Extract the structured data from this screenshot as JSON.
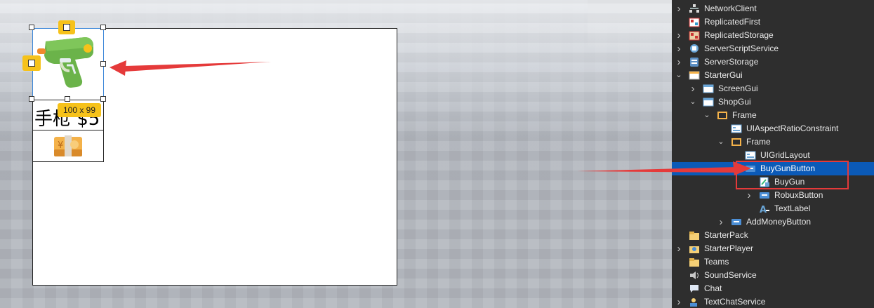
{
  "viewport": {
    "shop_item": {
      "price_text": "手枪 $5",
      "gun_icon": "water-gun-icon",
      "money_icon": "banknote-yen-icon"
    },
    "selection_size_label": "100 x 99",
    "colors": {
      "selection_tag": "#f6c21a",
      "arrow": "#e53a3a",
      "selection_outline": "#3b86d8"
    }
  },
  "explorer": {
    "colors": {
      "background": "#2e2e2e",
      "selected_row": "#0b5ab7"
    },
    "items": [
      {
        "label": "NetworkClient",
        "icon": "network-client-icon",
        "expandable": true,
        "expanded": false
      },
      {
        "label": "ReplicatedFirst",
        "icon": "replicated-first-icon",
        "expandable": false,
        "expanded": false
      },
      {
        "label": "ReplicatedStorage",
        "icon": "replicated-storage-icon",
        "expandable": true,
        "expanded": false
      },
      {
        "label": "ServerScriptService",
        "icon": "server-script-service-icon",
        "expandable": true,
        "expanded": false
      },
      {
        "label": "ServerStorage",
        "icon": "server-storage-icon",
        "expandable": true,
        "expanded": false
      },
      {
        "label": "StarterGui",
        "icon": "starter-gui-icon",
        "expandable": true,
        "expanded": true
      },
      {
        "label": "ScreenGui",
        "icon": "screen-gui-icon",
        "expandable": true,
        "expanded": false
      },
      {
        "label": "ShopGui",
        "icon": "screen-gui-icon",
        "expandable": true,
        "expanded": true
      },
      {
        "label": "Frame",
        "icon": "frame-icon",
        "expandable": true,
        "expanded": true
      },
      {
        "label": "UIAspectRatioConstraint",
        "icon": "ui-constraint-icon",
        "expandable": false,
        "expanded": false
      },
      {
        "label": "Frame",
        "icon": "frame-icon",
        "expandable": true,
        "expanded": true
      },
      {
        "label": "UIGridLayout",
        "icon": "ui-constraint-icon",
        "expandable": false,
        "expanded": false
      },
      {
        "label": "BuyGunButton",
        "icon": "text-button-icon",
        "expandable": true,
        "expanded": true,
        "selected": true
      },
      {
        "label": "BuyGun",
        "icon": "local-script-icon",
        "expandable": false,
        "expanded": false
      },
      {
        "label": "RobuxButton",
        "icon": "text-button-icon",
        "expandable": true,
        "expanded": false
      },
      {
        "label": "TextLabel",
        "icon": "text-label-icon",
        "expandable": false,
        "expanded": false
      },
      {
        "label": "AddMoneyButton",
        "icon": "text-button-icon",
        "expandable": true,
        "expanded": false
      },
      {
        "label": "StarterPack",
        "icon": "starter-pack-icon",
        "expandable": false,
        "expanded": false
      },
      {
        "label": "StarterPlayer",
        "icon": "starter-player-icon",
        "expandable": true,
        "expanded": false
      },
      {
        "label": "Teams",
        "icon": "teams-icon",
        "expandable": false,
        "expanded": false
      },
      {
        "label": "SoundService",
        "icon": "sound-service-icon",
        "expandable": false,
        "expanded": false
      },
      {
        "label": "Chat",
        "icon": "chat-icon",
        "expandable": false,
        "expanded": false
      },
      {
        "label": "TextChatService",
        "icon": "text-chat-service-icon",
        "expandable": true,
        "expanded": false
      }
    ]
  }
}
